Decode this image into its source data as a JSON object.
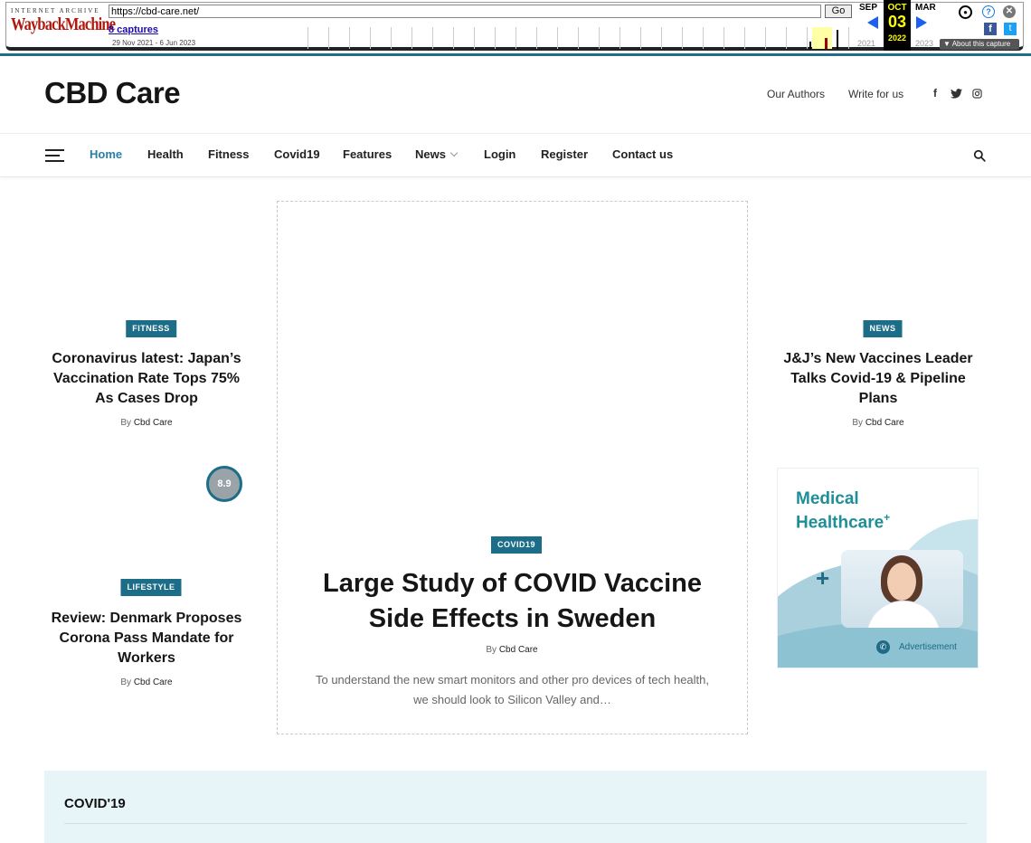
{
  "wayback": {
    "brand_top": "INTERNET ARCHIVE",
    "brand_bottom": "WaybackMachine",
    "url": "https://cbd-care.net/",
    "go_label": "Go",
    "captures": "8 captures",
    "range": "29 Nov 2021 - 6 Jun 2023",
    "months": [
      "SEP",
      "OCT",
      "MAR"
    ],
    "day": "03",
    "years": [
      "2021",
      "2022",
      "2023"
    ],
    "about_label": "About this capture"
  },
  "site": {
    "logo": "CBD Care",
    "top_links": [
      "Our Authors",
      "Write for us"
    ],
    "social_icons": [
      "facebook-icon",
      "twitter-icon",
      "instagram-icon"
    ]
  },
  "nav": {
    "items": [
      {
        "label": "Home",
        "active": true
      },
      {
        "label": "Health"
      },
      {
        "label": "Fitness"
      },
      {
        "label": "Covid19"
      },
      {
        "label": "Features"
      },
      {
        "label": "News",
        "has_dropdown": true
      },
      {
        "label": "Login"
      },
      {
        "label": "Register"
      },
      {
        "label": "Contact us"
      }
    ]
  },
  "posts": {
    "left_top": {
      "category": "FITNESS",
      "title": "Coronavirus latest: Japan’s Vaccination Rate Tops 75% As Cases Drop",
      "by": "By",
      "author": "Cbd Care"
    },
    "left_bottom": {
      "category": "LIFESTYLE",
      "title": "Review: Denmark Proposes Corona Pass Mandate for Workers",
      "by": "By",
      "author": "Cbd Care",
      "score": "8.9"
    },
    "feature": {
      "category": "COVID19",
      "title": "Large Study of COVID Vaccine Side Effects in Sweden",
      "by": "By",
      "author": "Cbd Care",
      "excerpt": "To understand the new smart monitors and other pro devices of tech health, we should look to Silicon Valley and…"
    },
    "right_top": {
      "category": "NEWS",
      "title": "J&J’s New Vaccines Leader Talks Covid-19 & Pipeline Plans",
      "by": "By",
      "author": "Cbd Care"
    }
  },
  "ad": {
    "headline1": "Medical",
    "headline2": "Healthcare",
    "headline_mark": "+",
    "label": "Advertisement"
  },
  "section": {
    "title": "COVID'19"
  },
  "colors": {
    "accent": "#1b6d88",
    "nav_active": "#2880a6",
    "section_bg": "#e7f5f8"
  }
}
